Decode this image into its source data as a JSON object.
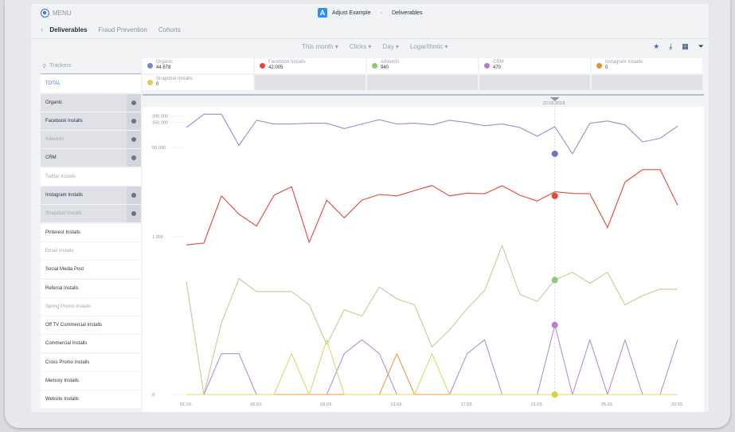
{
  "header": {
    "menu_label": "MENU",
    "app_name": "Adjust Example",
    "section": "Deliverables",
    "tabs": [
      {
        "label": "Deliverables",
        "active": true
      },
      {
        "label": "Fraud Prevention",
        "active": false
      },
      {
        "label": "Cohorts",
        "active": false
      }
    ]
  },
  "toolbar": {
    "filters": [
      "This month",
      "Clicks",
      "Day",
      "Logarithmic"
    ],
    "tool_icons": [
      "star-icon",
      "download-icon",
      "table-icon",
      "filter-icon"
    ]
  },
  "sidebar": {
    "search_placeholder": "Trackers",
    "items": [
      {
        "label": "TOTAL",
        "state": "total"
      },
      {
        "label": "Organic",
        "state": "selected"
      },
      {
        "label": "Facebook Installs",
        "state": "selected"
      },
      {
        "label": "Adwords",
        "state": "selected-muted"
      },
      {
        "label": "CRM",
        "state": "selected"
      },
      {
        "label": "Twitter Installs",
        "state": "muted"
      },
      {
        "label": "Instagram Installs",
        "state": "selected"
      },
      {
        "label": "Snapchat Installs",
        "state": "selected-muted"
      },
      {
        "label": "Pinterest Installs",
        "state": "normal"
      },
      {
        "label": "Email Installs",
        "state": "muted"
      },
      {
        "label": "Social Media Post",
        "state": "normal"
      },
      {
        "label": "Referral Installs",
        "state": "normal"
      },
      {
        "label": "Spring Promo Installs",
        "state": "muted"
      },
      {
        "label": "Off TV Commercial Installs",
        "state": "normal"
      },
      {
        "label": "Commercial Installs",
        "state": "normal"
      },
      {
        "label": "Cross Promo Installs",
        "state": "normal"
      },
      {
        "label": "Memory Installs",
        "state": "normal"
      },
      {
        "label": "Website Installs",
        "state": "normal"
      }
    ]
  },
  "legend_cards": [
    {
      "name": "Organic",
      "value": "44.678",
      "color": "#7f85c9"
    },
    {
      "name": "Facebook Installs",
      "value": "42.005",
      "color": "#e0483c"
    },
    {
      "name": "Adwords",
      "value": "940",
      "color": "#94c77a"
    },
    {
      "name": "CRM",
      "value": "470",
      "color": "#b77cc4"
    },
    {
      "name": "Instagram Installs",
      "value": "0",
      "color": "#ec8d2f"
    },
    {
      "name": "Snapchat Installs",
      "value": "0",
      "color": "#d7d24a"
    }
  ],
  "chart_data": {
    "type": "line",
    "scale": "logarithmic",
    "marker_date": "22.03.2018",
    "x": [
      "01.03.",
      "02.03.",
      "03.03.",
      "04.03.",
      "05.03.",
      "06.03.",
      "07.03.",
      "08.03.",
      "09.03.",
      "10.03.",
      "11.03.",
      "12.03.",
      "13.03.",
      "14.03.",
      "15.03.",
      "16.03.",
      "17.03.",
      "18.03.",
      "19.03.",
      "20.03.",
      "21.03.",
      "22.03.",
      "23.03.",
      "24.03.",
      "25.03.",
      "26.03.",
      "27.03.",
      "28.03.",
      "29.03."
    ],
    "x_tick_labels": [
      "01.03.",
      "05.03.",
      "09.03.",
      "13.03.",
      "17.03.",
      "21.03.",
      "25.03.",
      "29.03."
    ],
    "y_tick_labels": [
      "200.000",
      "150.000",
      "50.000",
      "1.000",
      "0"
    ],
    "series": [
      {
        "name": "Organic",
        "color": "#8f93cf",
        "values": [
          120000,
          215000,
          215000,
          55000,
          165000,
          140000,
          140000,
          145000,
          145000,
          115000,
          140000,
          170000,
          140000,
          145000,
          135000,
          165000,
          150000,
          130000,
          140000,
          120000,
          82000,
          125000,
          38000,
          145000,
          160000,
          135000,
          64000,
          75000,
          128000
        ]
      },
      {
        "name": "Facebook Installs",
        "color": "#e0483c",
        "values": [
          700,
          760,
          6000,
          2700,
          1600,
          6200,
          9000,
          780,
          5000,
          2300,
          5000,
          6400,
          6000,
          7600,
          9500,
          6000,
          6800,
          6600,
          9400,
          6200,
          4800,
          7200,
          6700,
          6600,
          1500,
          11000,
          19000,
          19000,
          4000
        ]
      },
      {
        "name": "Adwords",
        "color": "#c7c99a",
        "values": [
          140,
          0,
          22,
          160,
          90,
          90,
          90,
          50,
          8,
          40,
          30,
          110,
          65,
          50,
          7,
          16,
          42,
          95,
          680,
          80,
          58,
          150,
          210,
          130,
          210,
          50,
          75,
          100,
          100
        ]
      },
      {
        "name": "CRM",
        "color": "#b88ed0",
        "values": [
          0,
          0,
          5,
          5,
          0,
          0,
          0,
          0,
          0,
          5,
          10,
          5,
          0,
          0,
          0,
          0,
          5,
          10,
          0,
          0,
          0,
          20,
          0,
          10,
          0,
          10,
          0,
          0,
          10
        ]
      },
      {
        "name": "Instagram Installs",
        "color": "#ec9a4a",
        "values": [
          0,
          0,
          0,
          0,
          0,
          0,
          0,
          0,
          0,
          0,
          0,
          0,
          5,
          0,
          0,
          0,
          0,
          0,
          0,
          0,
          0,
          0,
          0,
          0,
          0,
          0,
          0,
          0,
          0
        ]
      },
      {
        "name": "Snapchat Installs",
        "color": "#ddd86a",
        "values": [
          0,
          0,
          0,
          0,
          0,
          0,
          5,
          0,
          10,
          0,
          0,
          0,
          0,
          0,
          5,
          0,
          0,
          0,
          0,
          0,
          0,
          0,
          0,
          0,
          0,
          0,
          0,
          0,
          0
        ]
      }
    ],
    "marker_index": 21,
    "marker_values": {
      "Organic": 38000,
      "Facebook Installs": 6000,
      "Adwords": 150,
      "CRM": 20,
      "Snapchat Installs": 0
    }
  }
}
